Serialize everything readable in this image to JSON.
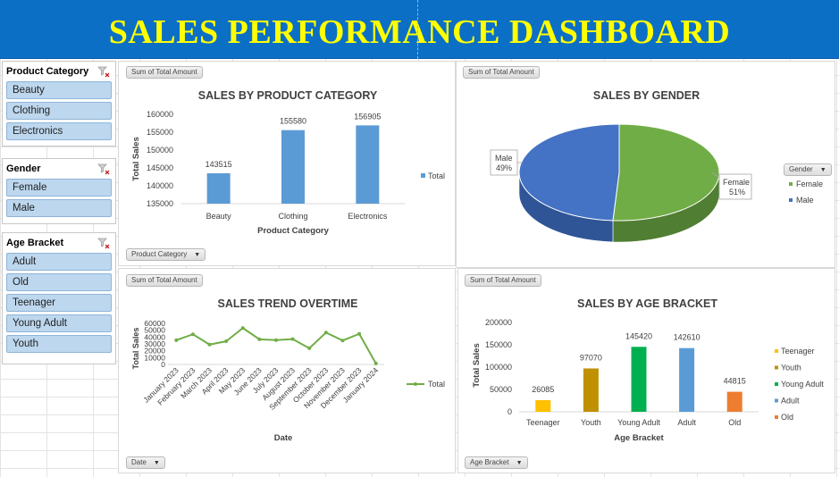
{
  "banner": {
    "title": "SALES PERFORMANCE DASHBOARD"
  },
  "slicers": {
    "product_category": {
      "title": "Product Category",
      "items": [
        "Beauty",
        "Clothing",
        "Electronics"
      ]
    },
    "gender": {
      "title": "Gender",
      "items": [
        "Female",
        "Male"
      ]
    },
    "age_bracket": {
      "title": "Age Bracket",
      "items": [
        "Adult",
        "Old",
        "Teenager",
        "Young Adult",
        "Youth"
      ]
    }
  },
  "panels": {
    "category": {
      "value_pill": "Sum of Total Amount",
      "filter_pill": "Product Category"
    },
    "gender": {
      "value_pill": "Sum of Total Amount",
      "legend_pill": "Gender"
    },
    "trend": {
      "value_pill": "Sum of Total Amount",
      "filter_pill": "Date"
    },
    "age": {
      "value_pill": "Sum of Total Amount",
      "filter_pill": "Age Bracket"
    }
  },
  "colors": {
    "banner": "#0b6fc6",
    "banner_text": "#ffff00",
    "bar_blue": "#5b9bd5",
    "female": "#70ad47",
    "male": "#4472c4",
    "line": "#70ad47",
    "teenager": "#ffc000",
    "youth": "#bf9000",
    "young_adult": "#00b050",
    "adult": "#5b9bd5",
    "old": "#ed7d31"
  },
  "chart_data": [
    {
      "type": "bar",
      "title": "SALES BY PRODUCT CATEGORY",
      "xlabel": "Product Category",
      "ylabel": "Total Sales",
      "categories": [
        "Beauty",
        "Clothing",
        "Electronics"
      ],
      "series": [
        {
          "name": "Total",
          "values": [
            143515,
            155580,
            156905
          ]
        }
      ],
      "ylim": [
        135000,
        160000
      ],
      "yticks": [
        135000,
        140000,
        145000,
        150000,
        155000,
        160000
      ],
      "data_labels": true,
      "legend": "right"
    },
    {
      "type": "pie",
      "title": "SALES BY GENDER",
      "slices": [
        {
          "label": "Female",
          "percent": 51,
          "percent_label": "51%"
        },
        {
          "label": "Male",
          "percent": 49,
          "percent_label": "49%"
        }
      ],
      "legend": "right"
    },
    {
      "type": "line",
      "title": "SALES TREND OVERTIME",
      "xlabel": "Date",
      "ylabel": "Total Sales",
      "categories": [
        "January 2023",
        "February 2023",
        "March 2023",
        "April 2023",
        "May 2023",
        "June 2023",
        "July 2023",
        "August 2023",
        "September 2023",
        "October 2023",
        "November 2023",
        "December 2023",
        "January 2024"
      ],
      "series": [
        {
          "name": "Total",
          "values": [
            35450,
            44060,
            28990,
            33870,
            53150,
            36715,
            35465,
            36960,
            23620,
            46580,
            34920,
            44690,
            1530
          ]
        }
      ],
      "ylim": [
        0,
        60000
      ],
      "yticks": [
        0,
        10000,
        20000,
        30000,
        40000,
        50000,
        60000
      ],
      "legend": "right"
    },
    {
      "type": "bar",
      "title": "SALES BY AGE BRACKET",
      "xlabel": "Age Bracket",
      "ylabel": "Total Sales",
      "categories": [
        "Teenager",
        "Youth",
        "Young Adult",
        "Adult",
        "Old"
      ],
      "series": [
        {
          "name": "Teenager",
          "values": [
            26085
          ]
        },
        {
          "name": "Youth",
          "values": [
            97070
          ]
        },
        {
          "name": "Young Adult",
          "values": [
            145420
          ]
        },
        {
          "name": "Adult",
          "values": [
            142610
          ]
        },
        {
          "name": "Old",
          "values": [
            44815
          ]
        }
      ],
      "ylim": [
        0,
        200000
      ],
      "yticks": [
        0,
        50000,
        100000,
        150000,
        200000
      ],
      "data_labels": true,
      "legend": "right"
    }
  ]
}
